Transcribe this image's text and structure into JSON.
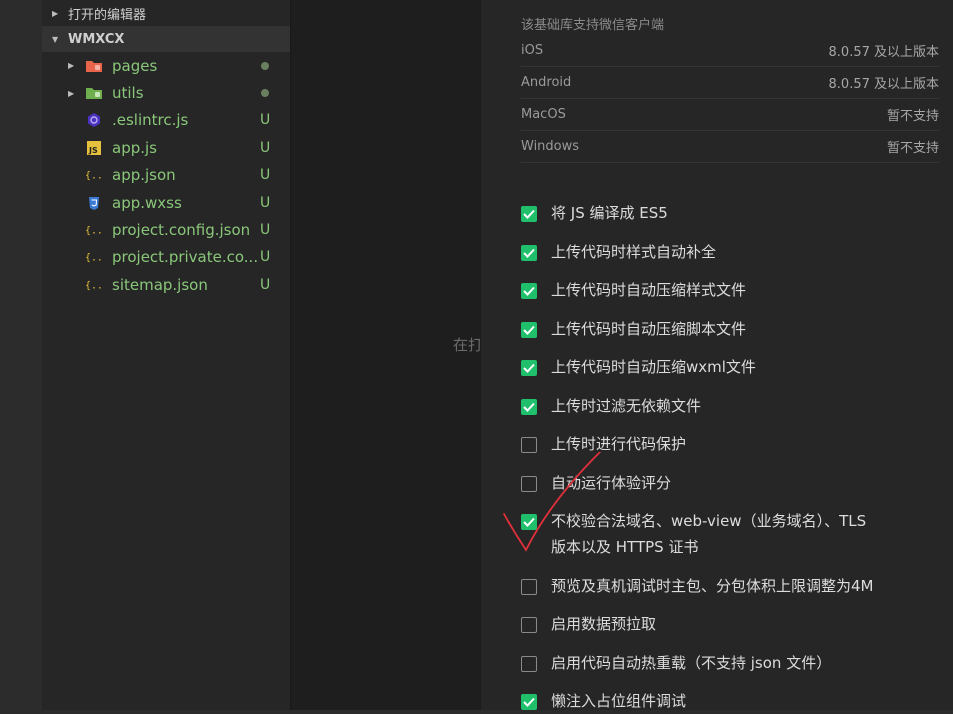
{
  "explorer": {
    "open_editors_label": "打开的编辑器",
    "project_label": "WMXCX",
    "items": [
      {
        "name": "pages",
        "type": "folder",
        "icon": "pages-folder-icon",
        "status": "dot"
      },
      {
        "name": "utils",
        "type": "folder",
        "icon": "utils-folder-icon",
        "status": "dot"
      },
      {
        "name": ".eslintrc.js",
        "type": "file",
        "icon": "eslint-icon",
        "status": "U"
      },
      {
        "name": "app.js",
        "type": "file",
        "icon": "js-file-icon",
        "status": "U"
      },
      {
        "name": "app.json",
        "type": "file",
        "icon": "json-file-icon",
        "status": "U"
      },
      {
        "name": "app.wxss",
        "type": "file",
        "icon": "css-file-icon",
        "status": "U"
      },
      {
        "name": "project.config.json",
        "type": "file",
        "icon": "json-file-icon",
        "status": "U"
      },
      {
        "name": "project.private.co...",
        "type": "file",
        "icon": "json-file-icon",
        "status": "U"
      },
      {
        "name": "sitemap.json",
        "type": "file",
        "icon": "json-file-icon",
        "status": "U"
      }
    ]
  },
  "editor": {
    "hint": "在打"
  },
  "settings": {
    "support_title": "该基础库支持微信客户端",
    "platforms": [
      {
        "name": "iOS",
        "value": "8.0.57 及以上版本"
      },
      {
        "name": "Android",
        "value": "8.0.57 及以上版本"
      },
      {
        "name": "MacOS",
        "value": "暂不支持"
      },
      {
        "name": "Windows",
        "value": "暂不支持"
      }
    ],
    "options": [
      {
        "label": "将 JS 编译成 ES5",
        "checked": true
      },
      {
        "label": "上传代码时样式自动补全",
        "checked": true
      },
      {
        "label": "上传代码时自动压缩样式文件",
        "checked": true
      },
      {
        "label": "上传代码时自动压缩脚本文件",
        "checked": true
      },
      {
        "label": "上传代码时自动压缩wxml文件",
        "checked": true
      },
      {
        "label": "上传时过滤无依赖文件",
        "checked": true
      },
      {
        "label": "上传时进行代码保护",
        "checked": false
      },
      {
        "label": "自动运行体验评分",
        "checked": false
      },
      {
        "label": "不校验合法域名、web-view（业务域名）、TLS",
        "label2": "版本以及 HTTPS 证书",
        "checked": true
      },
      {
        "label": "预览及真机调试时主包、分包体积上限调整为4M",
        "checked": false
      },
      {
        "label": "启用数据预拉取",
        "checked": false
      },
      {
        "label": "启用代码自动热重载（不支持 json 文件）",
        "checked": false
      },
      {
        "label": "懒注入占位组件调试",
        "checked": true
      }
    ]
  },
  "colors": {
    "check_green": "#1fbf6b",
    "file_green": "#8ac77a",
    "annotation_red": "#e0303a"
  }
}
